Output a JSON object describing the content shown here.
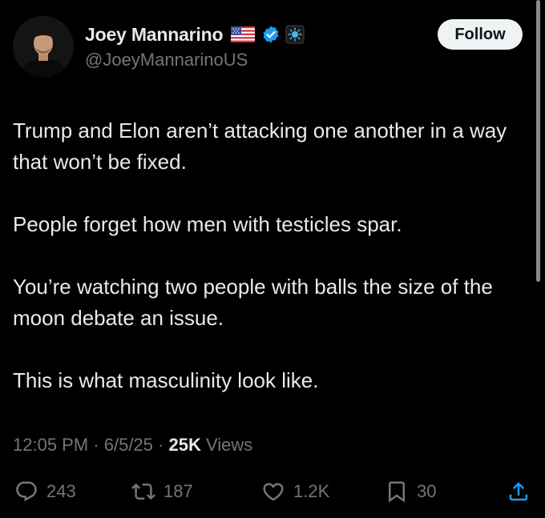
{
  "author": {
    "display_name": "Joey Mannarino",
    "handle": "@JoeyMannarinoUS",
    "verified": true
  },
  "follow_label": "Follow",
  "tweet": {
    "paragraphs": [
      "Trump and Elon aren’t attacking one another in a way that won’t be fixed.",
      "People forget how men with testicles spar.",
      "You’re watching two people with balls the size of the moon debate an issue.",
      "This is what masculinity look like."
    ],
    "time": "12:05 PM",
    "date": "6/5/25",
    "views_count": "25K",
    "views_label": "Views",
    "separator": " · "
  },
  "stats": {
    "replies": "243",
    "reposts": "187",
    "likes": "1.2K",
    "bookmarks": "30"
  },
  "colors": {
    "background": "#000000",
    "text": "#e7e9ea",
    "secondary": "#71767b",
    "verified_blue": "#1d9bf0",
    "follow_bg": "#eff3f4"
  }
}
